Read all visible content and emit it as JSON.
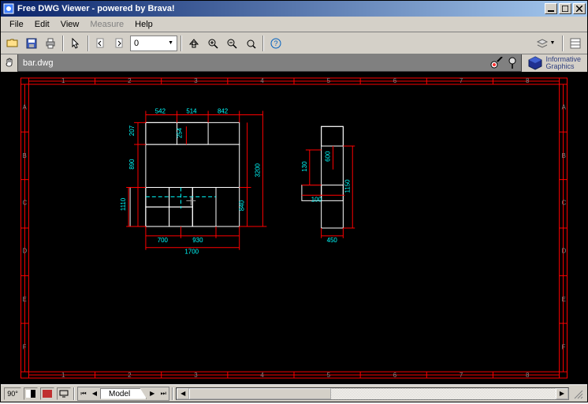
{
  "window": {
    "title": "Free DWG Viewer - powered by Brava!"
  },
  "menus": {
    "file": "File",
    "edit": "Edit",
    "view": "View",
    "measure": "Measure",
    "help": "Help"
  },
  "toolbar": {
    "page_value": "0"
  },
  "doc": {
    "filename": "bar.dwg"
  },
  "brand": {
    "line1": "Informative",
    "line2": "Graphics"
  },
  "status": {
    "rotate": "90°",
    "tab_name": "Model"
  },
  "grid": {
    "cols": [
      "1",
      "2",
      "3",
      "4",
      "5",
      "6",
      "7",
      "8"
    ],
    "rows": [
      "A",
      "B",
      "C",
      "D",
      "E",
      "F"
    ]
  },
  "dims_left": {
    "top1": "542",
    "top2": "514",
    "top3": "842",
    "left1": "207",
    "left2": "890",
    "left3": "1110",
    "mid_v": "254",
    "right1": "3200",
    "right2": "840",
    "bot1": "700",
    "bot2": "930",
    "bot3": "1700"
  },
  "dims_right": {
    "left1": "130",
    "mid": "100",
    "right": "1150",
    "inner": "600",
    "bot": "450"
  }
}
